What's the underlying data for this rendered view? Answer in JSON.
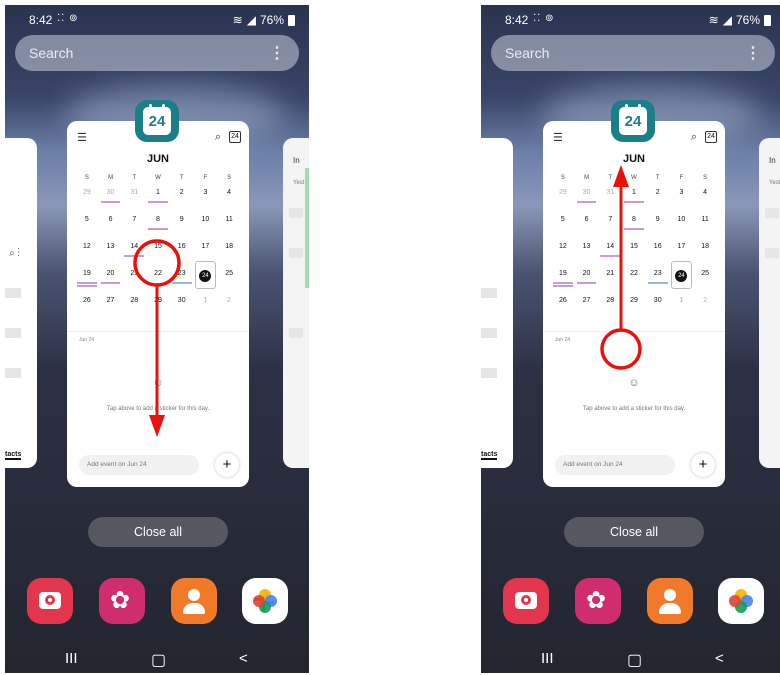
{
  "status_bar": {
    "time": "8:42",
    "battery": "76%"
  },
  "search": {
    "placeholder": "Search"
  },
  "left_app_card": {
    "tab_label": "tacts"
  },
  "right_app_card": {
    "title": "In",
    "subtitle": "Yest"
  },
  "calendar_app": {
    "icon_date": "24",
    "today_badge": "24",
    "month": "JUN",
    "weekdays": [
      "S",
      "M",
      "T",
      "W",
      "T",
      "F",
      "S"
    ],
    "weeks": [
      [
        "29",
        "30",
        "31",
        "1",
        "2",
        "3",
        "4"
      ],
      [
        "5",
        "6",
        "7",
        "8",
        "9",
        "10",
        "11"
      ],
      [
        "12",
        "13",
        "14",
        "15",
        "16",
        "17",
        "18"
      ],
      [
        "19",
        "20",
        "21",
        "22",
        "23",
        "24",
        "25"
      ],
      [
        "26",
        "27",
        "28",
        "29",
        "30",
        "1",
        "2"
      ]
    ],
    "selected_date_label": "Jun 24",
    "sticker_hint": "Tap above to add a sticker for this day.",
    "add_event_placeholder": "Add event on Jun 24",
    "add_button": "+"
  },
  "close_all_label": "Close all",
  "dock": [
    "camera-icon",
    "gallery-icon",
    "contacts-icon",
    "photos-icon"
  ],
  "nav": {
    "recents": "III",
    "home": "O",
    "back": "<"
  },
  "annotations": {
    "left_panel": "swipe down on calendar card",
    "right_panel": "swipe up on calendar card",
    "color": "#e8120c"
  }
}
